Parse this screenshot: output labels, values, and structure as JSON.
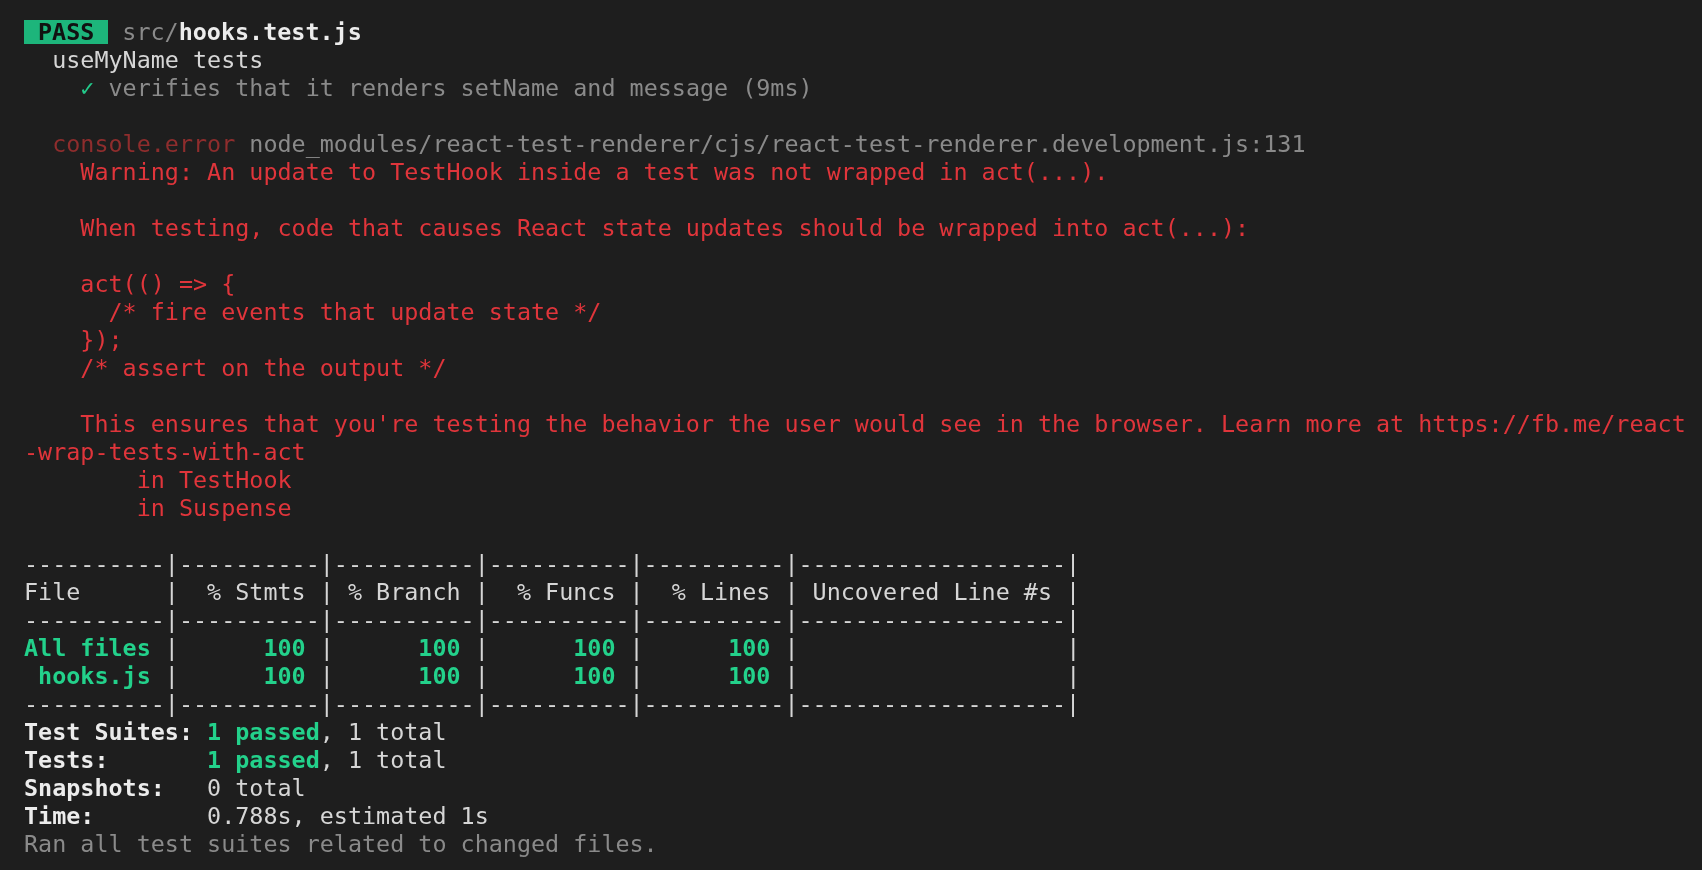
{
  "header": {
    "badge": "PASS",
    "path_dir": "src/",
    "path_file": "hooks.test.js"
  },
  "lines": [
    {
      "kind": "text",
      "segments": [
        {
          "kind": "plain",
          "text": "  useMyName tests"
        }
      ]
    },
    {
      "kind": "text",
      "segments": [
        {
          "kind": "green",
          "text": "    ✓"
        },
        {
          "kind": "dim",
          "text": " verifies that it renders setName and message (9ms)"
        }
      ]
    },
    {
      "kind": "blank"
    },
    {
      "kind": "text",
      "segments": [
        {
          "kind": "darkred",
          "text": "  console.error"
        },
        {
          "kind": "dim",
          "text": " node_modules/react-test-renderer/cjs/react-test-renderer.development.js:131"
        }
      ]
    },
    {
      "kind": "text",
      "segments": [
        {
          "kind": "red",
          "text": "    Warning: An update to TestHook inside a test was not wrapped in act(...)."
        }
      ]
    },
    {
      "kind": "blank"
    },
    {
      "kind": "text",
      "segments": [
        {
          "kind": "red",
          "text": "    When testing, code that causes React state updates should be wrapped into act(...):"
        }
      ]
    },
    {
      "kind": "blank"
    },
    {
      "kind": "text",
      "segments": [
        {
          "kind": "red",
          "text": "    act(() => {"
        }
      ]
    },
    {
      "kind": "text",
      "segments": [
        {
          "kind": "red",
          "text": "      /* fire events that update state */"
        }
      ]
    },
    {
      "kind": "text",
      "segments": [
        {
          "kind": "red",
          "text": "    });"
        }
      ]
    },
    {
      "kind": "text",
      "segments": [
        {
          "kind": "red",
          "text": "    /* assert on the output */"
        }
      ]
    },
    {
      "kind": "blank"
    },
    {
      "kind": "text",
      "segments": [
        {
          "kind": "red",
          "text": "    This ensures that you're testing the behavior the user would see in the browser. Learn more at https://fb.me/react"
        }
      ]
    },
    {
      "kind": "text",
      "segments": [
        {
          "kind": "red",
          "text": "-wrap-tests-with-act"
        }
      ]
    },
    {
      "kind": "text",
      "segments": [
        {
          "kind": "red",
          "text": "        in TestHook"
        }
      ]
    },
    {
      "kind": "text",
      "segments": [
        {
          "kind": "red",
          "text": "        in Suspense"
        }
      ]
    },
    {
      "kind": "blank"
    },
    {
      "kind": "text",
      "segments": [
        {
          "kind": "plain",
          "text": "----------|----------|----------|----------|----------|-------------------|"
        }
      ]
    },
    {
      "kind": "text",
      "segments": [
        {
          "kind": "plain",
          "text": "File      |  % Stmts | % Branch |  % Funcs |  % Lines | Uncovered Line #s |"
        }
      ]
    },
    {
      "kind": "text",
      "segments": [
        {
          "kind": "plain",
          "text": "----------|----------|----------|----------|----------|-------------------|"
        }
      ]
    },
    {
      "kind": "text",
      "segments": [
        {
          "kind": "greenbold",
          "text": "All files"
        },
        {
          "kind": "plain",
          "text": " |"
        },
        {
          "kind": "greenbold",
          "text": "      100"
        },
        {
          "kind": "plain",
          "text": " |"
        },
        {
          "kind": "greenbold",
          "text": "      100"
        },
        {
          "kind": "plain",
          "text": " |"
        },
        {
          "kind": "greenbold",
          "text": "      100"
        },
        {
          "kind": "plain",
          "text": " |"
        },
        {
          "kind": "greenbold",
          "text": "      100"
        },
        {
          "kind": "plain",
          "text": " |                   |"
        }
      ]
    },
    {
      "kind": "text",
      "segments": [
        {
          "kind": "greenbold",
          "text": " hooks.js"
        },
        {
          "kind": "plain",
          "text": " |"
        },
        {
          "kind": "greenbold",
          "text": "      100"
        },
        {
          "kind": "plain",
          "text": " |"
        },
        {
          "kind": "greenbold",
          "text": "      100"
        },
        {
          "kind": "plain",
          "text": " |"
        },
        {
          "kind": "greenbold",
          "text": "      100"
        },
        {
          "kind": "plain",
          "text": " |"
        },
        {
          "kind": "greenbold",
          "text": "      100"
        },
        {
          "kind": "plain",
          "text": " |                   |"
        }
      ]
    },
    {
      "kind": "text",
      "segments": [
        {
          "kind": "plain",
          "text": "----------|----------|----------|----------|----------|-------------------|"
        }
      ]
    },
    {
      "kind": "text",
      "segments": [
        {
          "kind": "bold",
          "text": "Test Suites: "
        },
        {
          "kind": "greenbold",
          "text": "1 passed"
        },
        {
          "kind": "plain",
          "text": ", 1 total"
        }
      ]
    },
    {
      "kind": "text",
      "segments": [
        {
          "kind": "bold",
          "text": "Tests:       "
        },
        {
          "kind": "greenbold",
          "text": "1 passed"
        },
        {
          "kind": "plain",
          "text": ", 1 total"
        }
      ]
    },
    {
      "kind": "text",
      "segments": [
        {
          "kind": "bold",
          "text": "Snapshots:   "
        },
        {
          "kind": "plain",
          "text": "0 total"
        }
      ]
    },
    {
      "kind": "text",
      "segments": [
        {
          "kind": "bold",
          "text": "Time:        "
        },
        {
          "kind": "plain",
          "text": "0.788s, estimated 1s"
        }
      ]
    },
    {
      "kind": "text",
      "segments": [
        {
          "kind": "dim",
          "text": "Ran all test suites related to changed files."
        }
      ]
    }
  ]
}
